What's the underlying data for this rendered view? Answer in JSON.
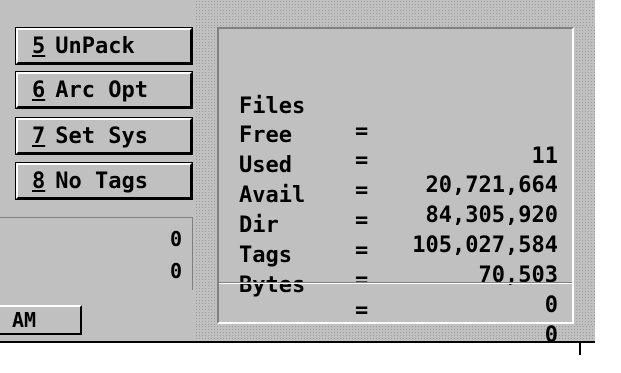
{
  "buttons": [
    {
      "num": "5",
      "label": "UnPack"
    },
    {
      "num": "6",
      "label": "Arc Opt"
    },
    {
      "num": "7",
      "label": "Set Sys"
    },
    {
      "num": "8",
      "label": "No Tags"
    }
  ],
  "left_panel": {
    "value1": "0",
    "value2": "0"
  },
  "info": {
    "rows": [
      {
        "label": "Files",
        "eq": "=",
        "value": "11"
      },
      {
        "label": "Free",
        "eq": "=",
        "value": "20,721,664"
      },
      {
        "label": "Used",
        "eq": "=",
        "value": "84,305,920"
      },
      {
        "label": "Avail",
        "eq": "=",
        "value": "105,027,584"
      },
      {
        "label": "Dir",
        "eq": "=",
        "value": "70,503"
      },
      {
        "label": "Tags",
        "eq": "=",
        "value": "0"
      },
      {
        "label": "Bytes",
        "eq": "=",
        "value": "0"
      }
    ]
  },
  "bottom_button": {
    "label": "AM"
  }
}
